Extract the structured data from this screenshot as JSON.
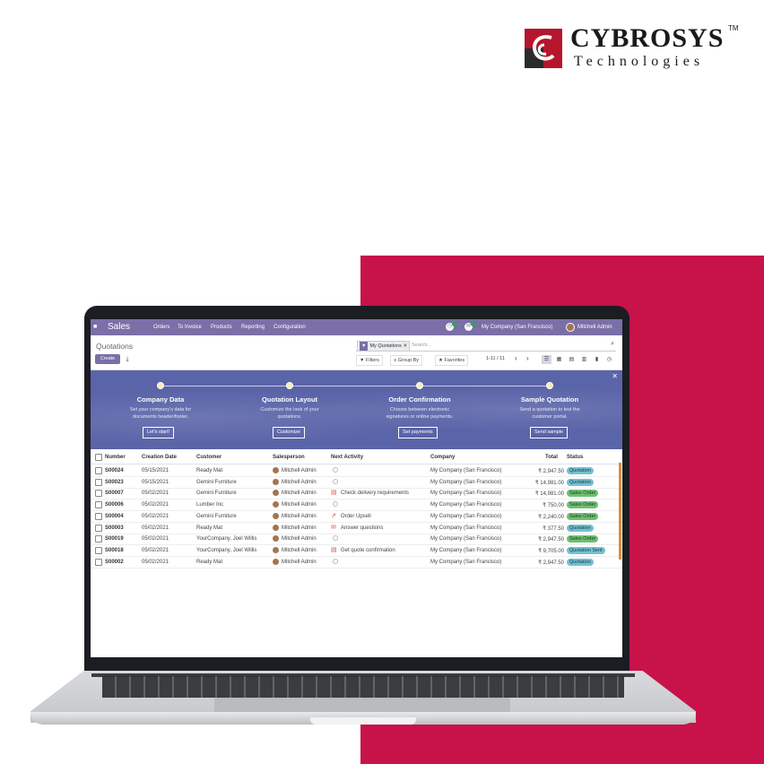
{
  "brand": {
    "name": "CYBROSYS",
    "tm": "TM",
    "subtitle": "Technologies",
    "colors": {
      "accent": "#c8124a",
      "mark": "#b5162d"
    }
  },
  "navbar": {
    "app_title": "Sales",
    "menu": [
      "Orders",
      "To Invoice",
      "Products",
      "Reporting",
      "Configuration"
    ],
    "company": "My Company (San Francisco)",
    "user": "Mitchell Admin",
    "color": "#7a6fa6"
  },
  "control_panel": {
    "breadcrumb": "Quotations",
    "create": "Create",
    "facet": "My Quotations",
    "search_placeholder": "Search...",
    "filters": "Filters",
    "group_by": "Group By",
    "favorites": "Favorites",
    "pager": "1-11 / 11"
  },
  "onboarding": {
    "steps": [
      {
        "title": "Company Data",
        "desc1": "Set your company's data for",
        "desc2": "documents header/footer.",
        "button": "Let's start!"
      },
      {
        "title": "Quotation Layout",
        "desc1": "Customize the look of your",
        "desc2": "quotations.",
        "button": "Customize"
      },
      {
        "title": "Order Confirmation",
        "desc1": "Choose between electronic",
        "desc2": "signatures or online payments.",
        "button": "Set payments"
      },
      {
        "title": "Sample Quotation",
        "desc1": "Send a quotation to test the",
        "desc2": "customer portal.",
        "button": "Send sample"
      }
    ]
  },
  "table": {
    "headers": [
      "Number",
      "Creation Date",
      "Customer",
      "Salesperson",
      "Next Activity",
      "Company",
      "Total",
      "Status"
    ],
    "rows": [
      {
        "number": "S00024",
        "date": "05/15/2021",
        "customer": "Ready Mat",
        "salesperson": "Mitchell Admin",
        "activity": "",
        "activity_icon": "",
        "company": "My Company (San Francisco)",
        "total": "₹ 2,947.50",
        "status": "Quotation",
        "status_kind": "quotation"
      },
      {
        "number": "S00023",
        "date": "05/15/2021",
        "customer": "Gemini Furniture",
        "salesperson": "Mitchell Admin",
        "activity": "",
        "activity_icon": "",
        "company": "My Company (San Francisco)",
        "total": "₹ 14,981.00",
        "status": "Quotation",
        "status_kind": "quotation"
      },
      {
        "number": "S00007",
        "date": "05/02/2021",
        "customer": "Gemini Furniture",
        "salesperson": "Mitchell Admin",
        "activity": "Check delivery requirements",
        "activity_icon": "calendar-icon",
        "company": "My Company (San Francisco)",
        "total": "₹ 14,981.00",
        "status": "Sales Order",
        "status_kind": "order"
      },
      {
        "number": "S00006",
        "date": "05/02/2021",
        "customer": "Lumber Inc",
        "salesperson": "Mitchell Admin",
        "activity": "",
        "activity_icon": "",
        "company": "My Company (San Francisco)",
        "total": "₹ 750.00",
        "status": "Sales Order",
        "status_kind": "order"
      },
      {
        "number": "S00004",
        "date": "05/02/2021",
        "customer": "Gemini Furniture",
        "salesperson": "Mitchell Admin",
        "activity": "Order Upsell",
        "activity_icon": "chart-icon",
        "company": "My Company (San Francisco)",
        "total": "₹ 2,240.00",
        "status": "Sales Order",
        "status_kind": "order"
      },
      {
        "number": "S00003",
        "date": "05/02/2021",
        "customer": "Ready Mat",
        "salesperson": "Mitchell Admin",
        "activity": "Answer questions",
        "activity_icon": "envelope-icon",
        "company": "My Company (San Francisco)",
        "total": "₹ 377.50",
        "status": "Quotation",
        "status_kind": "quotation"
      },
      {
        "number": "S00019",
        "date": "05/02/2021",
        "customer": "YourCompany, Joel Willis",
        "salesperson": "Mitchell Admin",
        "activity": "",
        "activity_icon": "",
        "company": "My Company (San Francisco)",
        "total": "₹ 2,947.50",
        "status": "Sales Order",
        "status_kind": "order"
      },
      {
        "number": "S00018",
        "date": "05/02/2021",
        "customer": "YourCompany, Joel Willis",
        "salesperson": "Mitchell Admin",
        "activity": "Get quote confirmation",
        "activity_icon": "calendar-icon",
        "company": "My Company (San Francisco)",
        "total": "₹ 9,705.00",
        "status": "Quotation Sent",
        "status_kind": "sent"
      },
      {
        "number": "S00002",
        "date": "05/02/2021",
        "customer": "Ready Mat",
        "salesperson": "Mitchell Admin",
        "activity": "",
        "activity_icon": "",
        "company": "My Company (San Francisco)",
        "total": "₹ 2,947.50",
        "status": "Quotation",
        "status_kind": "quotation"
      }
    ]
  }
}
